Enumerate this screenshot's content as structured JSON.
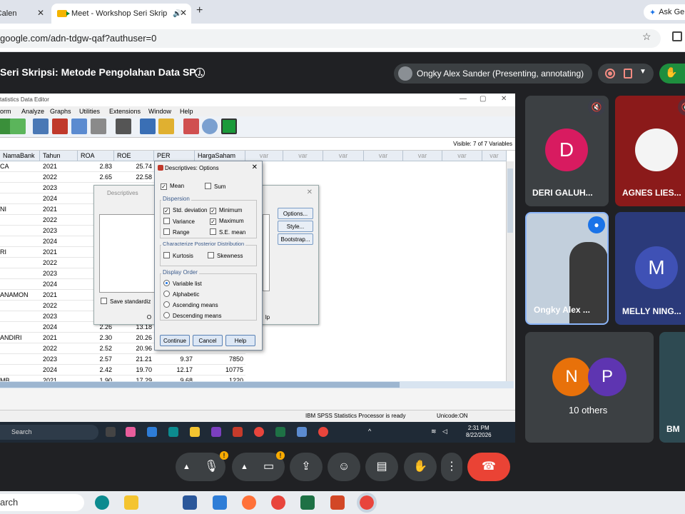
{
  "browser": {
    "tabs": [
      {
        "label": "- Calen",
        "active": false
      },
      {
        "label": "Meet - Workshop Seri Skrip",
        "active": true
      }
    ],
    "ask_label": "Ask Ge",
    "url": "google.com/adn-tdgw-qaf?authuser=0"
  },
  "meet": {
    "title": "Seri Skripsi: Metode Pengolahan Data SP...",
    "presenter_label": "Ongky Alex Sander (Presenting, annotating)"
  },
  "spss": {
    "title": "tatistics Data Editor",
    "menu": [
      "orm",
      "Analyze",
      "Graphs",
      "Utilities",
      "Extensions",
      "Window",
      "Help"
    ],
    "visible_label": "Visible: 7 of 7 Variables",
    "columns": [
      "NamaBank",
      "Tahun",
      "ROA",
      "ROE",
      "PER",
      "HargaSaham",
      "var",
      "var",
      "var",
      "var",
      "var",
      "var",
      "var"
    ],
    "rows": [
      {
        "bank": "CA",
        "year": "2021",
        "roa": "2.83",
        "roe": "25.74",
        "per": "",
        "price": ""
      },
      {
        "bank": "",
        "year": "2022",
        "roa": "2.65",
        "roe": "22.58",
        "per": "",
        "price": ""
      },
      {
        "bank": "",
        "year": "2023",
        "roa": "",
        "roe": "",
        "per": "",
        "price": ""
      },
      {
        "bank": "",
        "year": "2024",
        "roa": "",
        "roe": "",
        "per": "",
        "price": ""
      },
      {
        "bank": "NI",
        "year": "2021",
        "roa": "",
        "roe": "",
        "per": "",
        "price": ""
      },
      {
        "bank": "",
        "year": "2022",
        "roa": "",
        "roe": "",
        "per": "",
        "price": ""
      },
      {
        "bank": "",
        "year": "2023",
        "roa": "",
        "roe": "",
        "per": "",
        "price": ""
      },
      {
        "bank": "",
        "year": "2024",
        "roa": "",
        "roe": "",
        "per": "",
        "price": ""
      },
      {
        "bank": "RI",
        "year": "2021",
        "roa": "",
        "roe": "",
        "per": "",
        "price": ""
      },
      {
        "bank": "",
        "year": "2022",
        "roa": "",
        "roe": "",
        "per": "",
        "price": ""
      },
      {
        "bank": "",
        "year": "2023",
        "roa": "",
        "roe": "",
        "per": "",
        "price": ""
      },
      {
        "bank": "",
        "year": "2024",
        "roa": "",
        "roe": "",
        "per": "",
        "price": ""
      },
      {
        "bank": "ANAMON",
        "year": "2021",
        "roa": "",
        "roe": "",
        "per": "",
        "price": ""
      },
      {
        "bank": "",
        "year": "2022",
        "roa": "",
        "roe": "",
        "per": "",
        "price": ""
      },
      {
        "bank": "",
        "year": "2023",
        "roa": "",
        "roe": "",
        "per": "",
        "price": ""
      },
      {
        "bank": "",
        "year": "2024",
        "roa": "2.26",
        "roe": "13.18",
        "per": "",
        "price": ""
      },
      {
        "bank": "ANDIRI",
        "year": "2021",
        "roa": "2.30",
        "roe": "20.26",
        "per": "",
        "price": ""
      },
      {
        "bank": "",
        "year": "2022",
        "roa": "2.52",
        "roe": "20.96",
        "per": "",
        "price": ""
      },
      {
        "bank": "",
        "year": "2023",
        "roa": "2.57",
        "roe": "21.21",
        "per": "9.37",
        "price": "7850"
      },
      {
        "bank": "",
        "year": "2024",
        "roa": "2.42",
        "roe": "19.70",
        "per": "12.17",
        "price": "10775"
      },
      {
        "bank": "MB",
        "year": "2021",
        "roa": "1.90",
        "roe": "17.29",
        "per": "9.68",
        "price": "1220"
      }
    ],
    "status_processor": "IBM SPSS Statistics Processor is ready",
    "status_unicode": "Unicode:ON"
  },
  "descriptives": {
    "title": "Descriptives",
    "save_label": "Save standardiz",
    "buttons": [
      "Options...",
      "Style...",
      "Bootstrap..."
    ],
    "ok_partial": "O",
    "help_partial": "lp"
  },
  "options": {
    "title": "Descriptives: Options",
    "mean": "Mean",
    "sum": "Sum",
    "dispersion_label": "Dispersion",
    "std_dev": "Std. deviation",
    "minimum": "Minimum",
    "variance": "Variance",
    "maximum": "Maximum",
    "range": "Range",
    "se_mean": "S.E. mean",
    "posterior_label": "Characterize Posterior Distribution",
    "kurtosis": "Kurtosis",
    "skewness": "Skewness",
    "display_order_label": "Display Order",
    "order_variable": "Variable list",
    "order_alpha": "Alphabetic",
    "order_asc": "Ascending means",
    "order_desc": "Descending means",
    "continue_btn": "Continue",
    "cancel_btn": "Cancel",
    "help_btn": "Help"
  },
  "inner_taskbar": {
    "search": "Search",
    "time": "2:31 PM",
    "date": "8/22/2026"
  },
  "participants": [
    {
      "name": "DERI GALUH...",
      "initial": "D",
      "color": "#d81b60"
    },
    {
      "name": "AGNES LIES...",
      "initial": "",
      "color": "#8b1a1a"
    },
    {
      "name": "Ongky Alex ...",
      "initial": "",
      "color": "#9bb0c8"
    },
    {
      "name": "MELLY NING...",
      "initial": "M",
      "color": "#3f51b5"
    },
    {
      "name": "10 others",
      "initial": "N",
      "initial2": "P"
    },
    {
      "name": "BM",
      "initial": "",
      "color": "#2e4a52"
    }
  ],
  "outer_taskbar": {
    "search": "arch"
  }
}
